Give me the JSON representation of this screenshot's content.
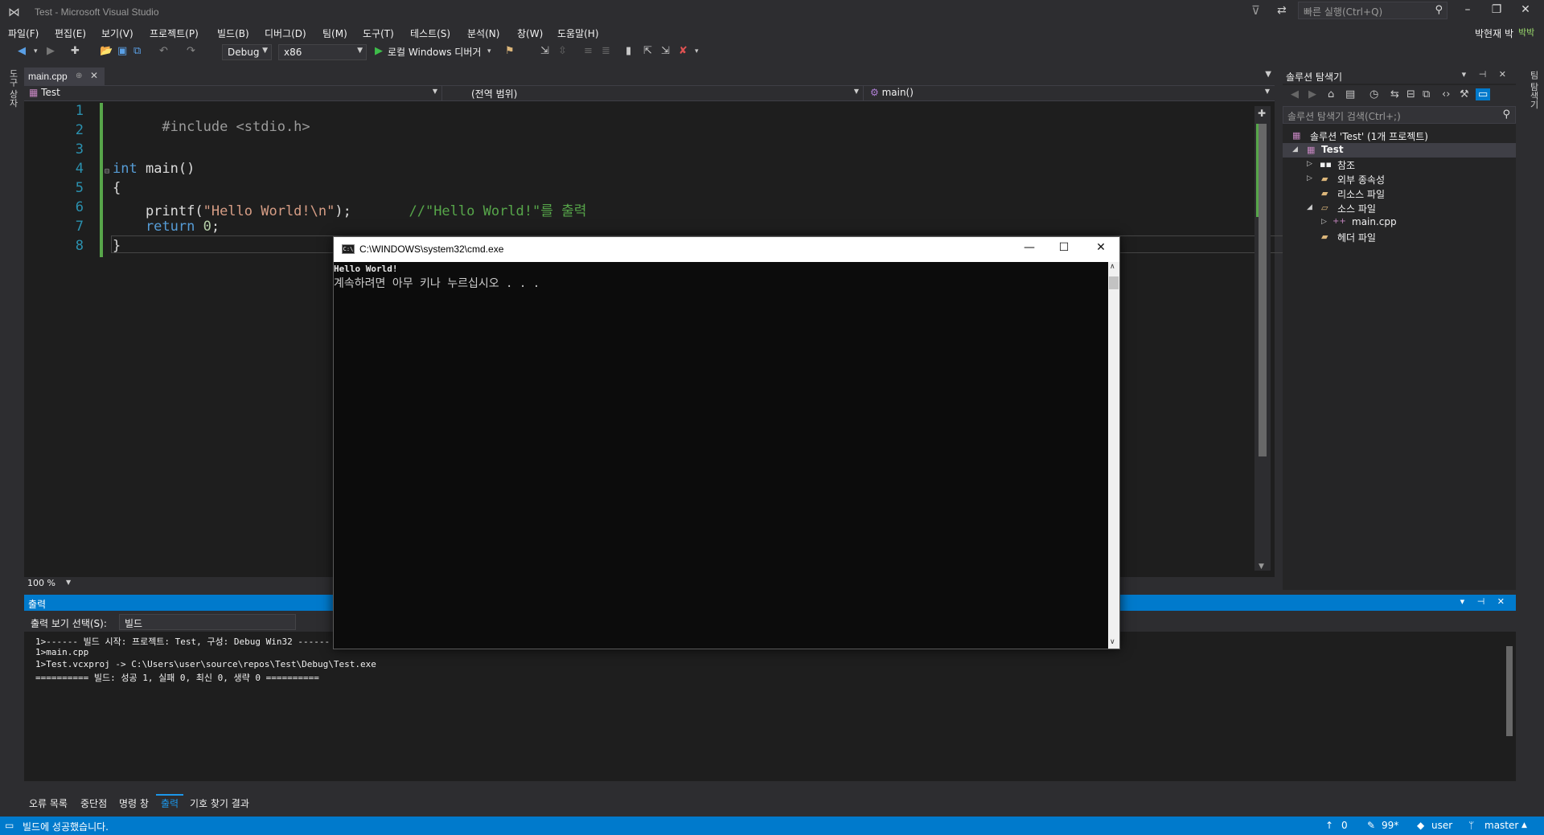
{
  "window": {
    "title": "Test - Microsoft Visual Studio",
    "quick_launch_placeholder": "빠른 실행(Ctrl+Q)",
    "user_name": "박현재 박",
    "user_badge": "박박"
  },
  "menu": [
    "파일(F)",
    "편집(E)",
    "보기(V)",
    "프로젝트(P)",
    "빌드(B)",
    "디버그(D)",
    "팀(M)",
    "도구(T)",
    "테스트(S)",
    "분석(N)",
    "창(W)",
    "도움말(H)"
  ],
  "toolbar": {
    "config": "Debug",
    "platform": "x86",
    "debugger": "로컬 Windows 디버거"
  },
  "left_strip_label": "도구 상자",
  "right_strip_label": "팀 탐색기",
  "editor": {
    "tab": "main.cpp",
    "nav_project": "Test",
    "nav_scope": "(전역 범위)",
    "nav_member": "main()",
    "zoom": "100 %",
    "line_numbers": [
      "1",
      "2",
      "3",
      "4",
      "5",
      "6",
      "7",
      "8"
    ],
    "code": {
      "l1_pp": "#include <stdio.h>",
      "l4_kw": "int",
      "l4_rest": " main()",
      "l5": "{",
      "l6_fn": "    printf(",
      "l6_str": "\"Hello World!\\n\"",
      "l6_end": ");",
      "l6_comment": "       //\"Hello World!\"를 출력",
      "l7_kw": "    return",
      "l7_num": "0",
      "l7_end": ";",
      "l8": "}"
    }
  },
  "solution_explorer": {
    "title": "솔루션 탐색기",
    "search_placeholder": "솔루션 탐색기 검색(Ctrl+;)",
    "items": [
      {
        "label": "솔루션 'Test' (1개 프로젝트)"
      },
      {
        "label": "Test"
      },
      {
        "label": "참조"
      },
      {
        "label": "외부 종속성"
      },
      {
        "label": "리소스 파일"
      },
      {
        "label": "소스 파일"
      },
      {
        "label": "main.cpp"
      },
      {
        "label": "헤더 파일"
      }
    ]
  },
  "output": {
    "title": "출력",
    "select_label": "출력 보기 선택(S):",
    "select_value": "빌드",
    "lines": [
      "1>------ 빌드 시작: 프로젝트: Test, 구성: Debug Win32 ------",
      "1>main.cpp",
      "1>Test.vcxproj -> C:\\Users\\user\\source\\repos\\Test\\Debug\\Test.exe",
      "========== 빌드: 성공 1, 실패 0, 최신 0, 생략 0 =========="
    ]
  },
  "bottom_tabs": [
    "오류 목록",
    "중단점",
    "명령 창",
    "출력",
    "기호 찾기 결과"
  ],
  "status": {
    "message": "빌드에 성공했습니다.",
    "up_count": "0",
    "edits": "99*",
    "repo_user": "user",
    "branch": "master"
  },
  "console": {
    "title": "C:\\WINDOWS\\system32\\cmd.exe",
    "icon_text": "C:\\",
    "line1": "Hello World!",
    "line2": "계속하려면 아무 키나 누르십시오 . . ."
  },
  "colors": {
    "accent": "#007acc",
    "editor_bg": "#1e1e1e",
    "keyword": "#569cd6",
    "string": "#d69d85",
    "comment": "#57a64a",
    "line_number": "#2b91af"
  }
}
